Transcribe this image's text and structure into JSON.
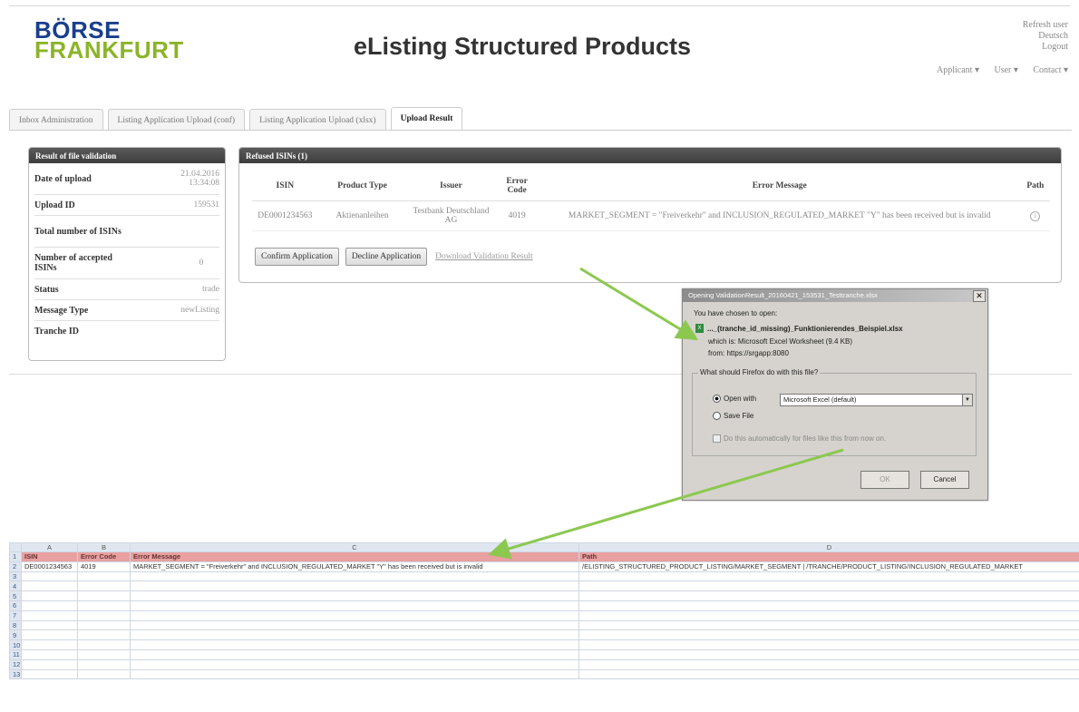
{
  "logo": {
    "line1": "BÖRSE",
    "line2": "FRANKFURT"
  },
  "app_title": "eListing Structured Products",
  "top_links": [
    "Refresh user",
    "Deutsch",
    "Logout"
  ],
  "top_nav": [
    "Applicant ▾",
    "User ▾",
    "Contact ▾"
  ],
  "tabs": [
    {
      "label": "Inbox Administration"
    },
    {
      "label": "Listing Application Upload (conf)"
    },
    {
      "label": "Listing Application Upload (xlsx)"
    },
    {
      "label": "Upload Result"
    }
  ],
  "result_panel": {
    "title": "Result of file validation",
    "rows": [
      {
        "label": "Date of upload",
        "value": "21.04.2016 13:34:08"
      },
      {
        "label": "Upload ID",
        "value": "159531"
      },
      {
        "label": "Total number of ISINs",
        "value": ""
      },
      {
        "label": "Number of accepted ISINs",
        "value": "0"
      },
      {
        "label": "Status",
        "value": "trade"
      },
      {
        "label": "Message Type",
        "value": "newListing"
      },
      {
        "label": "Tranche ID",
        "value": ""
      }
    ]
  },
  "refused_panel": {
    "title": "Refused ISINs (1)",
    "columns": [
      "ISIN",
      "Product Type",
      "Issuer",
      "Error Code",
      "Error Message",
      "Path"
    ],
    "row": {
      "isin": "DE0001234563",
      "product_type": "Aktienanleihen",
      "issuer": "Testbank Deutschland AG",
      "error_code": "4019",
      "error_message": "MARKET_SEGMENT = \"Freiverkehr\" and INCLUSION_REGULATED_MARKET \"Y\" has been received but is invalid",
      "path_icon": "info-circle-icon"
    },
    "confirm_label": "Confirm Application",
    "decline_label": "Decline Application",
    "download_label": "Download Validation Result"
  },
  "dialog": {
    "title": "Opening ValidationResult_20160421_153531_Testtranche.xlsx",
    "intro": "You have chosen to open:",
    "file_name": "..._(tranche_id_missing)_Funktionierendes_Beispiel.xlsx",
    "which_is": "which is: Microsoft Excel Worksheet (9.4 KB)",
    "from": "from: https://srgapp:8080",
    "question": "What should Firefox do with this file?",
    "open_with_label": "Open with",
    "open_with_value": "Microsoft Excel (default)",
    "save_label": "Save File",
    "auto_label": "Do this automatically for files like this from now on.",
    "ok_label": "OK",
    "cancel_label": "Cancel"
  },
  "spreadsheet": {
    "columns": [
      "A",
      "B",
      "C",
      "D"
    ],
    "header": [
      "ISIN",
      "Error Code",
      "Error Message",
      "Path"
    ],
    "data_row": [
      "DE0001234563",
      "4019",
      "MARKET_SEGMENT = \"Freiverkehr\" and INCLUSION_REGULATED_MARKET \"Y\" has been received but is invalid",
      "/ELISTING_STRUCTURED_PRODUCT_LISTING/MARKET_SEGMENT | /TRANCHE/PRODUCT_LISTING/INCLUSION_REGULATED_MARKET"
    ],
    "row_numbers": [
      "1",
      "2",
      "3",
      "4",
      "5",
      "6",
      "7",
      "8",
      "9",
      "10",
      "11",
      "12",
      "13"
    ]
  },
  "colors": {
    "brand_blue": "#1a3e8c",
    "brand_green": "#8cb428",
    "arrow": "#8cc850",
    "excel_header": "#e8a0a0"
  }
}
